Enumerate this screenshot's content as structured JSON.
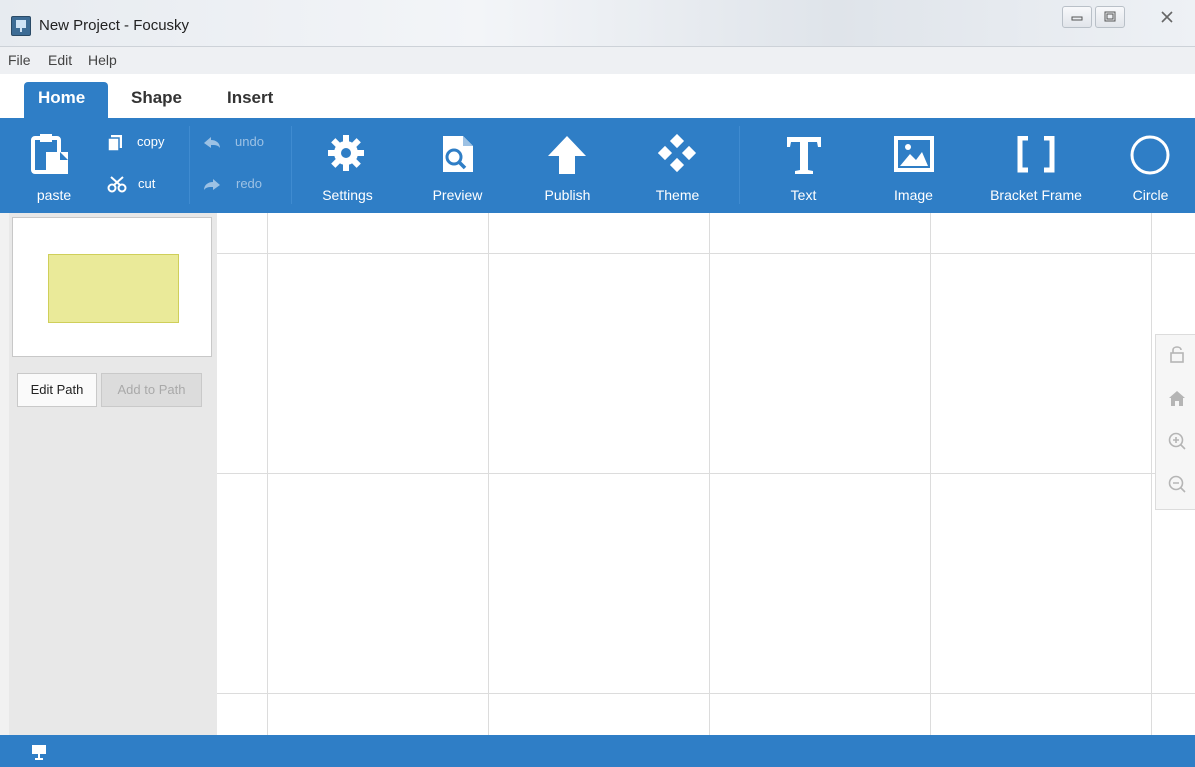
{
  "window": {
    "title": "New Project - Focusky"
  },
  "menu": {
    "items": [
      "File",
      "Edit",
      "Help"
    ]
  },
  "tabs": [
    {
      "label": "Home",
      "active": true
    },
    {
      "label": "Shape",
      "active": false
    },
    {
      "label": "Insert",
      "active": false
    }
  ],
  "ribbon": {
    "paste": "paste",
    "copy": "copy",
    "cut": "cut",
    "undo": "undo",
    "redo": "redo",
    "settings": "Settings",
    "preview": "Preview",
    "publish": "Publish",
    "theme": "Theme",
    "text": "Text",
    "image": "Image",
    "bracket_frame": "Bracket Frame",
    "circle": "Circle"
  },
  "path_panel": {
    "edit_path": "Edit Path",
    "add_to_path": "Add to Path"
  },
  "side_tools": [
    "lock-icon",
    "home-icon",
    "zoom-in-icon",
    "zoom-out-icon"
  ],
  "colors": {
    "accent": "#2f7ec6",
    "frame_fill": "#eaea99"
  }
}
